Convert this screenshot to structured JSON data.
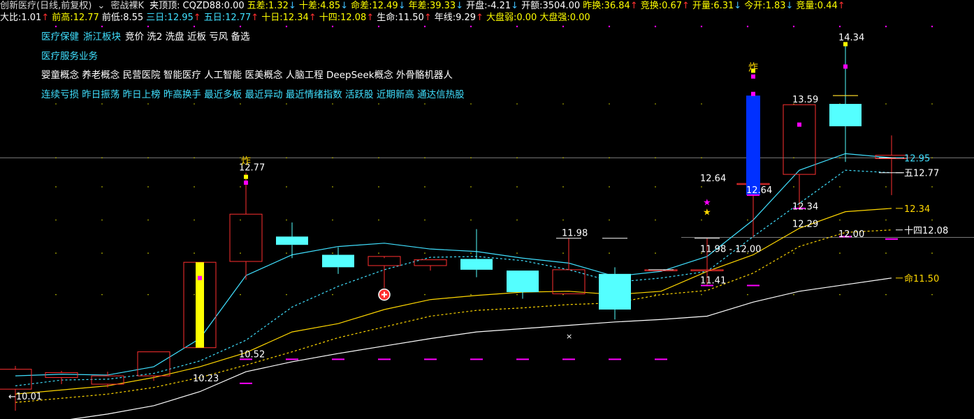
{
  "header": {
    "title": "创新医疗(日线,前复权)",
    "indicator": "密战裸K",
    "line1": [
      {
        "label": "夹顶顶:",
        "value": "",
        "color": "#ffffff"
      },
      {
        "label": "CQZD88:",
        "value": "0.00",
        "color": "#ffffff"
      },
      {
        "label": "五差:",
        "value": "1.32",
        "arrow": "down",
        "color": "#ffff00"
      },
      {
        "label": "十差:",
        "value": "4.85",
        "arrow": "down",
        "color": "#ffff00"
      },
      {
        "label": "命差:",
        "value": "12.49",
        "arrow": "down",
        "color": "#ffff00"
      },
      {
        "label": "年差:",
        "value": "39.33",
        "arrow": "down",
        "color": "#ffff00"
      },
      {
        "label": "开盘:",
        "value": "-4.21",
        "arrow": "down",
        "color": "#ffffff"
      },
      {
        "label": "开额:",
        "value": "3504.00",
        "color": "#ffffff"
      },
      {
        "label": "昨换:",
        "value": "36.84",
        "arrow": "up",
        "color": "#ffff00"
      },
      {
        "label": "竞换:",
        "value": "0.67",
        "arrow": "up",
        "color": "#ffff00"
      },
      {
        "label": "开量:",
        "value": "6.31",
        "arrow": "down",
        "color": "#ffff00"
      },
      {
        "label": "今开:",
        "value": "1.83",
        "arrow": "down",
        "color": "#ffff00"
      },
      {
        "label": "竞量:",
        "value": "0.44",
        "arrow": "up",
        "color": "#ffff00"
      }
    ],
    "line2": [
      {
        "label": "大比:",
        "value": "1.01",
        "arrow": "up",
        "color": "#ffffff"
      },
      {
        "label": "前高:",
        "value": "12.77",
        "color": "#ffff00"
      },
      {
        "label": "前低:",
        "value": "8.55",
        "color": "#ffffff"
      },
      {
        "label": "三日:",
        "value": "12.95",
        "arrow": "up",
        "color": "#40e0ff"
      },
      {
        "label": "五日:",
        "value": "12.77",
        "arrow": "up",
        "color": "#40e0ff"
      },
      {
        "label": "十日:",
        "value": "12.34",
        "arrow": "up",
        "color": "#ffff00"
      },
      {
        "label": "十四:",
        "value": "12.08",
        "arrow": "up",
        "color": "#ffff00"
      },
      {
        "label": "生命:",
        "value": "11.50",
        "arrow": "up",
        "color": "#ffffff"
      },
      {
        "label": "年线:",
        "value": "9.29",
        "arrow": "up",
        "color": "#ffffff"
      },
      {
        "label": "大盘弱:",
        "value": "0.00",
        "color": "#ffff00"
      },
      {
        "label": "大盘强:",
        "value": "0.00",
        "color": "#ffff00"
      }
    ]
  },
  "tags": {
    "row1": [
      {
        "text": "医疗保健",
        "color": "#40e0ff"
      },
      {
        "text": "浙江板块",
        "color": "#40e0ff"
      },
      {
        "text": "竞价 洗2 洗盘 近板 亏风 备选",
        "color": "#ffffff"
      }
    ],
    "row2": [
      {
        "text": "医疗服务业务",
        "color": "#40e0ff"
      }
    ],
    "row3": [
      {
        "text": "婴童概念 养老概念 民营医院 智能医疗 人工智能 医美概念 人脑工程 DeepSeek概念 外骨骼机器人",
        "color": "#ffffff"
      }
    ],
    "row4": [
      {
        "text": "连续亏损 昨日振荡 昨日上榜 昨高换手 最近多板 最近异动 最近情绪指数 活跃股 近期新高 通达信热股",
        "color": "#40e0ff"
      }
    ]
  },
  "colors": {
    "up": "#ff3030",
    "down": "#54ffff",
    "ma3": "#40e0ff",
    "ma5": "#40e0ff",
    "ma10": "#ffd700",
    "ma14": "#ffd700",
    "ma_life": "#ffffff",
    "magenta": "#ff00ff"
  },
  "chart_data": {
    "type": "candlestick",
    "ylim": [
      9.8,
      14.55
    ],
    "candles": [
      {
        "o": 10.16,
        "h": 10.44,
        "l": 9.9,
        "c": 10.4
      },
      {
        "o": 10.3,
        "h": 10.38,
        "l": 10.22,
        "c": 10.36
      },
      {
        "o": 10.22,
        "h": 10.37,
        "l": 10.18,
        "c": 10.32
      },
      {
        "o": 10.32,
        "h": 10.61,
        "l": 10.26,
        "c": 10.61
      },
      {
        "o": 10.66,
        "h": 11.69,
        "l": 10.66,
        "c": 11.69
      },
      {
        "o": 11.7,
        "h": 12.77,
        "l": 11.48,
        "c": 12.27
      },
      {
        "o": 12.0,
        "h": 12.17,
        "l": 11.74,
        "c": 11.9
      },
      {
        "o": 11.78,
        "h": 11.87,
        "l": 11.55,
        "c": 11.63
      },
      {
        "o": 11.65,
        "h": 11.74,
        "l": 11.38,
        "c": 11.76
      },
      {
        "o": 11.65,
        "h": 11.72,
        "l": 11.59,
        "c": 11.72
      },
      {
        "o": 11.73,
        "h": 12.09,
        "l": 11.51,
        "c": 11.6
      },
      {
        "o": 11.59,
        "h": 11.59,
        "l": 11.25,
        "c": 11.33
      },
      {
        "o": 11.31,
        "h": 11.98,
        "l": 11.31,
        "c": 11.6
      },
      {
        "o": 11.55,
        "h": 11.63,
        "l": 11.0,
        "c": 11.12
      },
      {
        "o": 11.6,
        "h": 11.6,
        "l": 11.6,
        "c": 11.6
      },
      {
        "o": 11.6,
        "h": 11.98,
        "l": 11.4,
        "c": 11.6
      },
      {
        "o": 12.64,
        "h": 13.7,
        "l": 12.0,
        "c": 12.64
      },
      {
        "o": 12.75,
        "h": 13.59,
        "l": 12.34,
        "c": 13.59
      },
      {
        "o": 13.6,
        "h": 14.34,
        "l": 12.9,
        "c": 13.33
      },
      {
        "o": 12.94,
        "h": 13.22,
        "l": 12.5,
        "c": 12.98
      }
    ],
    "ma3": [
      10.32,
      10.34,
      10.33,
      10.43,
      10.77,
      11.53,
      11.78,
      11.88,
      11.92,
      11.85,
      11.82,
      11.74,
      11.68,
      11.52,
      11.58,
      11.76,
      12.2,
      12.8,
      13.0,
      12.95
    ],
    "ma5": [
      10.2,
      10.27,
      10.28,
      10.35,
      10.5,
      10.75,
      11.15,
      11.4,
      11.6,
      11.75,
      11.76,
      11.71,
      11.6,
      11.45,
      11.5,
      11.58,
      12.0,
      12.4,
      12.8,
      12.77
    ],
    "ma10": [
      10.1,
      10.15,
      10.2,
      10.3,
      10.43,
      10.6,
      10.85,
      10.95,
      11.12,
      11.24,
      11.29,
      11.33,
      11.34,
      11.3,
      11.34,
      11.58,
      11.78,
      12.1,
      12.3,
      12.34
    ],
    "ma14": [
      10.0,
      10.05,
      10.1,
      10.18,
      10.3,
      10.45,
      10.61,
      10.78,
      10.91,
      11.04,
      11.11,
      11.14,
      11.18,
      11.2,
      11.3,
      11.35,
      11.56,
      11.88,
      12.05,
      12.08
    ],
    "ma_life": [
      9.7,
      9.78,
      9.86,
      9.96,
      10.13,
      10.37,
      10.49,
      10.59,
      10.68,
      10.77,
      10.85,
      10.89,
      10.93,
      10.97,
      11.0,
      11.04,
      11.21,
      11.34,
      11.42,
      11.5
    ],
    "price_labels": [
      {
        "text": "12.77",
        "x": 5,
        "y": 12.77,
        "color": "#ffffff"
      },
      {
        "text": "10.52",
        "x": 5,
        "y": 10.52,
        "color": "#ffffff"
      },
      {
        "text": "10.23",
        "x": 4,
        "y": 10.23,
        "color": "#ffffff"
      },
      {
        "text": "←10.01",
        "x": 0,
        "y": 10.01,
        "color": "#ffffff"
      },
      {
        "text": "11.98",
        "x": 12,
        "y": 11.98,
        "color": "#ffffff"
      },
      {
        "text": "11.98 - 12.00",
        "x": 15,
        "y": 11.79,
        "color": "#ffffff"
      },
      {
        "text": "11.41",
        "x": 15,
        "y": 11.41,
        "color": "#ffffff"
      },
      {
        "text": "12.64",
        "x": 15,
        "y": 12.64,
        "color": "#ffffff"
      },
      {
        "text": "12.64",
        "x": 16,
        "y": 12.5,
        "color": "#ffffff"
      },
      {
        "text": "13.59",
        "x": 17,
        "y": 13.59,
        "color": "#ffffff"
      },
      {
        "text": "12.34",
        "x": 17,
        "y": 12.3,
        "color": "#ffffff"
      },
      {
        "text": "12.29",
        "x": 17,
        "y": 12.09,
        "color": "#ffffff"
      },
      {
        "text": "12.00",
        "x": 18,
        "y": 11.97,
        "color": "#ffffff"
      },
      {
        "text": "14.34",
        "x": 18,
        "y": 14.34,
        "color": "#ffffff"
      }
    ],
    "right_labels": [
      {
        "text": "12.95",
        "y": 12.95,
        "color": "#40e0ff"
      },
      {
        "text": "五12.77",
        "y": 12.77,
        "color": "#ffffff"
      },
      {
        "text": "12.34",
        "y": 12.34,
        "color": "#ffd700"
      },
      {
        "text": "十四12.08",
        "y": 12.08,
        "color": "#ffffff"
      },
      {
        "text": "命11.50",
        "y": 11.5,
        "color": "#ffd700"
      }
    ],
    "marks": [
      {
        "text": "炸",
        "x": 5,
        "y": 12.87,
        "color": "#ffd700"
      },
      {
        "text": "炸",
        "x": 16,
        "y": 14.0,
        "color": "#ffd700"
      }
    ]
  }
}
